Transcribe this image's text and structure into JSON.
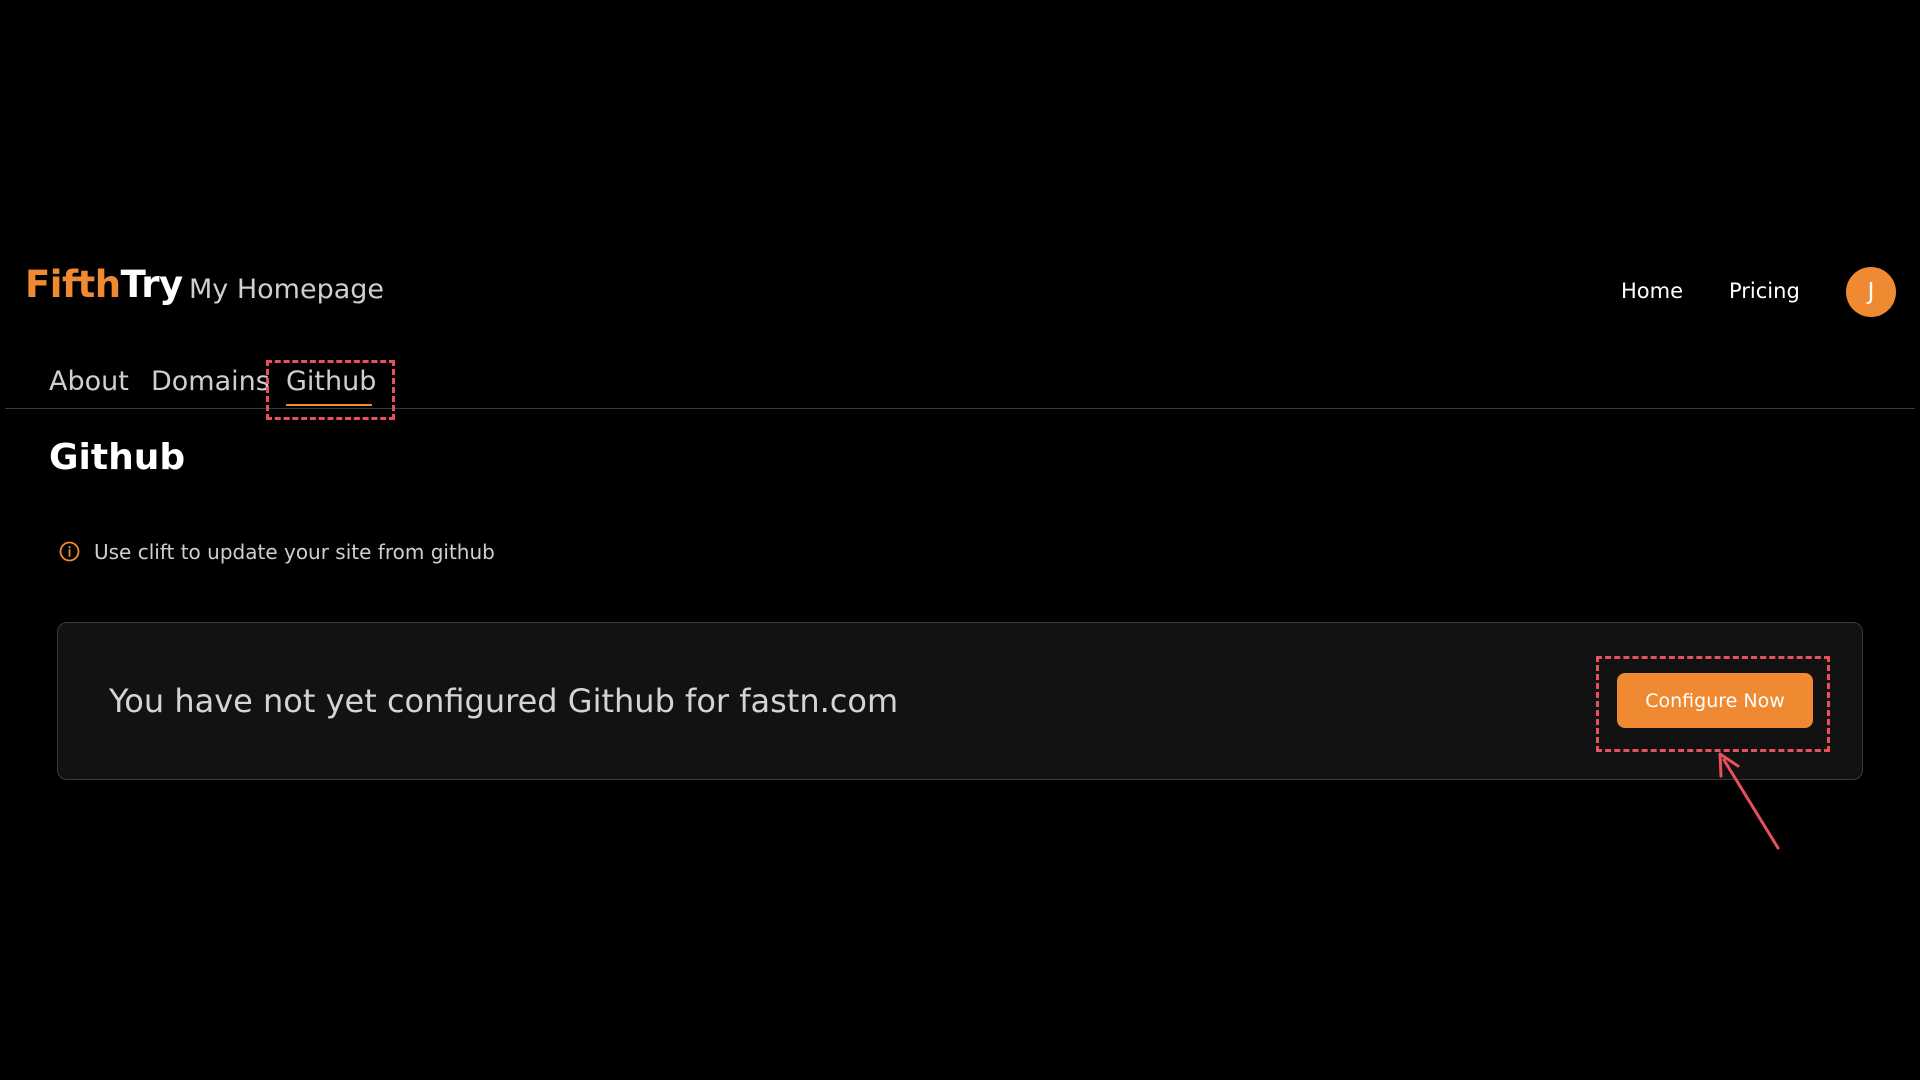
{
  "header": {
    "logo_part1": "Fifth",
    "logo_part2": "Try",
    "site_name": "My Homepage",
    "nav": [
      {
        "label": "Home"
      },
      {
        "label": "Pricing"
      }
    ],
    "avatar_initial": "J"
  },
  "tabs": [
    {
      "label": "About",
      "active": false
    },
    {
      "label": "Domains",
      "active": false
    },
    {
      "label": "Github",
      "active": true
    }
  ],
  "main": {
    "title": "Github",
    "info_text": "Use clift to update your site from github",
    "card_message": "You have not yet configured Github for fastn.com",
    "cta_label": "Configure Now"
  },
  "colors": {
    "accent": "#f08a32",
    "background": "#000000",
    "card_background": "#121212",
    "annotation": "#e8505b"
  },
  "icons": {
    "info": "info-circle-icon",
    "annotation_arrow": "arrow-icon"
  }
}
